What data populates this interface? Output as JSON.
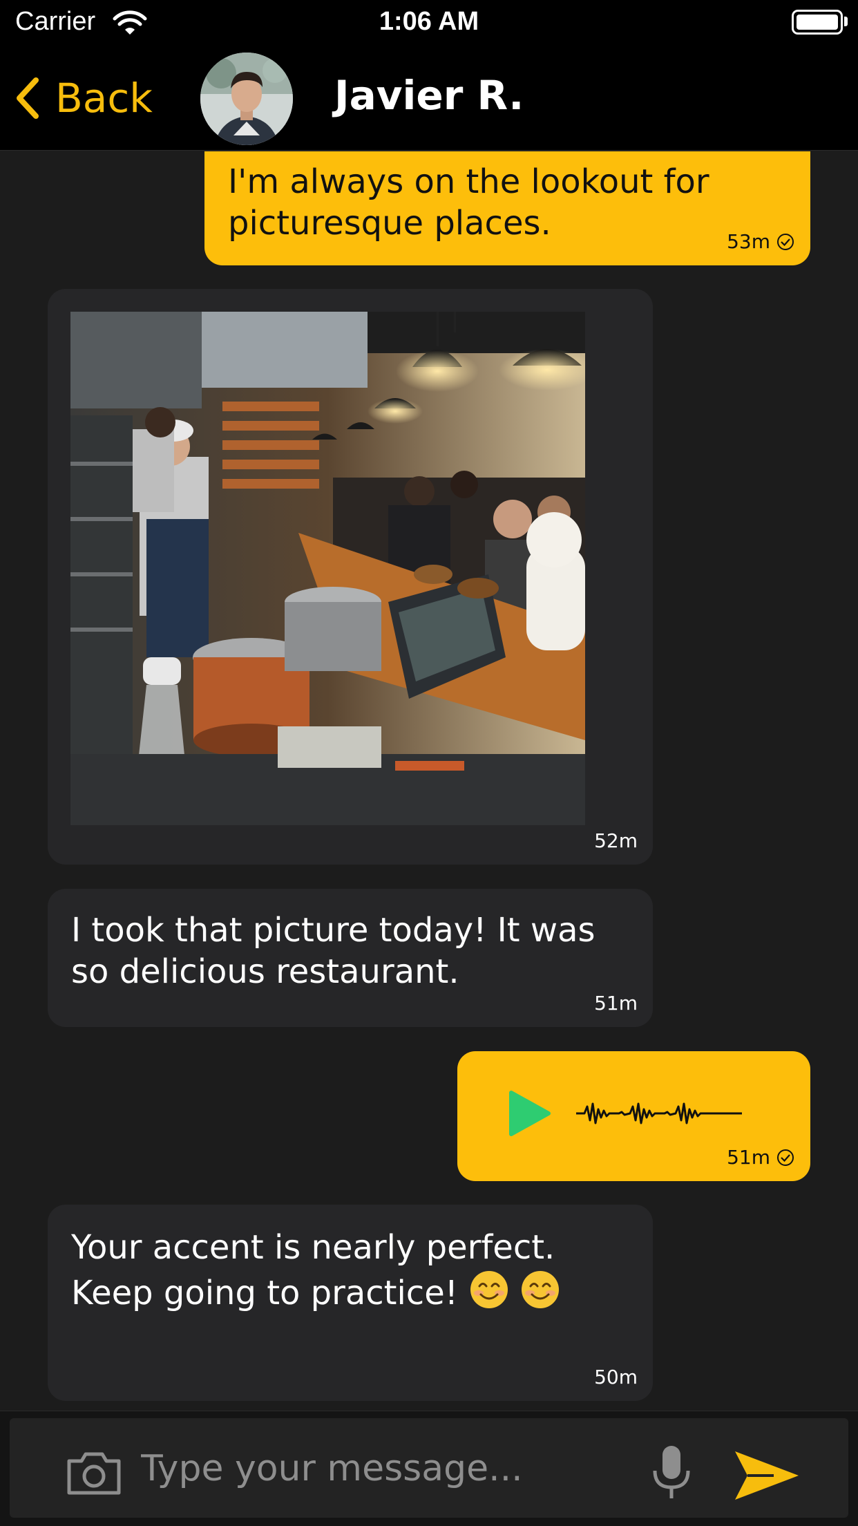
{
  "status_bar": {
    "carrier": "Carrier",
    "time": "1:06 AM",
    "icons": [
      "wifi-icon",
      "battery-icon"
    ]
  },
  "nav": {
    "back_label": "Back",
    "contact_name": "Javier R.",
    "accent_color": "#f7bd0d"
  },
  "messages": [
    {
      "direction": "out",
      "type": "text",
      "text": "I'm always on the lookout for picturesque places.",
      "time": "53m",
      "read": true
    },
    {
      "direction": "in",
      "type": "image",
      "image": "restaurant-kitchen-photo",
      "time": "52m"
    },
    {
      "direction": "in",
      "type": "text",
      "text": "I took that picture today! It was so delicious restaurant.",
      "time": "51m"
    },
    {
      "direction": "out",
      "type": "voice",
      "time": "51m",
      "read": true
    },
    {
      "direction": "in",
      "type": "text",
      "text": "Your accent is nearly perfect. Keep going to practice!",
      "emoji": [
        "smiling-face",
        "smiling-face"
      ],
      "time": "50m"
    }
  ],
  "composer": {
    "placeholder": "Type your message...",
    "value": "",
    "icons": [
      "camera-icon",
      "microphone-icon",
      "send-icon"
    ]
  },
  "colors": {
    "outgoing_bubble": "#fdbe0b",
    "incoming_bubble": "#262628",
    "background": "#1c1c1c",
    "play_button": "#2ecc71"
  }
}
